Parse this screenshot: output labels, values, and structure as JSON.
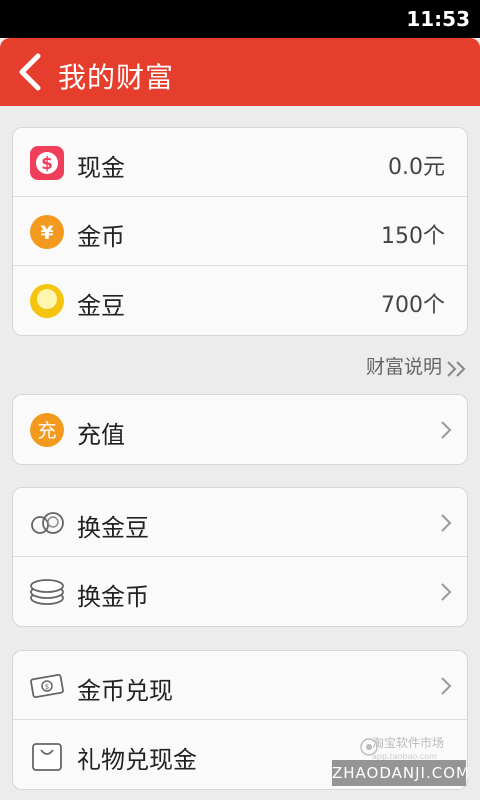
{
  "status_bar": {
    "time": "11:53"
  },
  "header": {
    "title": "我的财富"
  },
  "balances": [
    {
      "label": "现金",
      "value": "0.0元",
      "icon": "cash-icon",
      "color": "#ef3f5a"
    },
    {
      "label": "金币",
      "value": "150个",
      "icon": "gold-coin-icon",
      "color": "#f39a1e"
    },
    {
      "label": "金豆",
      "value": "700个",
      "icon": "gold-bean-icon",
      "color": "#f5c40e"
    }
  ],
  "wealth_info_link": "财富说明",
  "recharge": {
    "label": "充值",
    "icon": "recharge-icon",
    "icon_text": "充",
    "color": "#f39a1e"
  },
  "exchange": [
    {
      "label": "换金豆",
      "icon": "beans-outline-icon"
    },
    {
      "label": "换金币",
      "icon": "coins-stack-icon"
    }
  ],
  "redeem": [
    {
      "label": "金币兑现",
      "icon": "cash-note-icon"
    },
    {
      "label": "礼物兑现金",
      "icon": "gift-bag-icon"
    }
  ],
  "watermark": {
    "brand": "淘宝软件市场",
    "sub": "app.taobao.com",
    "site": "ZHAODANJI.COM"
  }
}
